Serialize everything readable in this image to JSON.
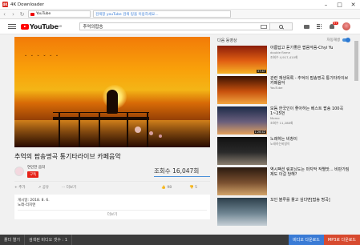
{
  "window": {
    "title": "4K Downloader"
  },
  "browser": {
    "tab_label": "YouTube",
    "url": "검색창 youTube 검색 링을 이용하세요..."
  },
  "youtube": {
    "logo": "YouTube",
    "logo_region": "KR",
    "search_query": "추억의팝송",
    "notification_count": "9+"
  },
  "video": {
    "title": "추억의 팝송명곡 통기타라이브 카페음악",
    "channel": "연인한 음악",
    "subscribe_label": "구독",
    "views": "조회수 16,047회",
    "actions": [
      "추가",
      "공유",
      "더보기"
    ],
    "likes": "98",
    "dislikes": "5",
    "published": "게시일: 2018. 8. 6.",
    "category": "노래-리지엔",
    "more_label": "더보기"
  },
  "sidebar": {
    "heading": "다음 동영상",
    "autoplay_label": "자동재생",
    "items": [
      {
        "title": "아름답고 듣기좋은 팝음악음-Chyi Yu",
        "channel": "double flame",
        "stats": "조회수 4,917,410회",
        "duration": "37:47",
        "colors": [
          "#8a1d0a",
          "#e15f12",
          "#f5b327"
        ]
      },
      {
        "title": "관련 재생목록 - 추억의 팝송명곡 통기타라이브 카페음악",
        "channel": "YouTube",
        "stats": "",
        "duration": "",
        "colors": [
          "#3b1202",
          "#c8510d",
          "#f2a540"
        ]
      },
      {
        "title": "모듬 한국인이 좋아하는 베스트 팝송 100곡1~25번",
        "channel": "Momo",
        "stats": "조회수 11,288회",
        "duration": "1:26:42",
        "colors": [
          "#1c2b48",
          "#6a5f7d",
          "#e3a15c"
        ]
      },
      {
        "title": "노래하는 비창이",
        "channel": "노래하는비창이",
        "stats": "",
        "duration": "",
        "colors": [
          "#111111",
          "#2a2a2a",
          "#8a7e6f"
        ]
      },
      {
        "title": "역시팩션 링포닝도는 마지막 작별맛... 비판가짐제도 이걸 당해?",
        "channel": "",
        "stats": "",
        "duration": "",
        "colors": [
          "#2a1a0f",
          "#7a5030",
          "#d2a46a"
        ]
      },
      {
        "title": "꼬인 블루를 풀고 싶다면[팝송 명곡]",
        "channel": "",
        "stats": "",
        "duration": "",
        "colors": [
          "#2c3e4a",
          "#6e8491",
          "#c7d0d6"
        ]
      }
    ]
  },
  "bottom_bar": {
    "open_label": "폴더 열기",
    "status_label": "검색된 비디오 갯수 : 1",
    "download_label": "비디오 다운로드",
    "audio_label": "MP3로 다운로드"
  },
  "colors": {
    "youtube_red": "#ff0000",
    "subscribe_red": "#e62117",
    "accent_blue": "#3a7bd5",
    "mp3_orange": "#d74a2f"
  }
}
